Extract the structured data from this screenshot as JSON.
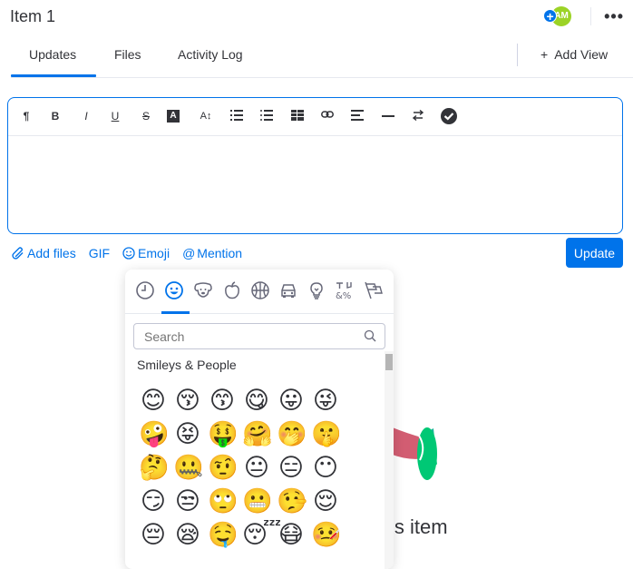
{
  "header": {
    "title": "Item 1",
    "avatar_initials": "AM",
    "add_subscriber_symbol": "+",
    "more_symbol": "•••"
  },
  "tabs": [
    {
      "label": "Updates",
      "active": true
    },
    {
      "label": "Files",
      "active": false
    },
    {
      "label": "Activity Log",
      "active": false
    }
  ],
  "add_view": {
    "icon": "+",
    "label": "Add View"
  },
  "toolbar": {
    "buttons": [
      {
        "name": "paragraph",
        "glyph": "¶"
      },
      {
        "name": "bold",
        "glyph": "B"
      },
      {
        "name": "italic",
        "glyph": "I"
      },
      {
        "name": "underline",
        "glyph": "U"
      },
      {
        "name": "strikethrough",
        "glyph": "S"
      },
      {
        "name": "text-color",
        "glyph": "A"
      },
      {
        "name": "font-size",
        "glyph": "A↕"
      },
      {
        "name": "numbered-list",
        "glyph": "≡"
      },
      {
        "name": "bulleted-list",
        "glyph": "≡"
      },
      {
        "name": "table",
        "glyph": "▦"
      },
      {
        "name": "link",
        "glyph": "∞"
      },
      {
        "name": "align",
        "glyph": "≡"
      },
      {
        "name": "divider",
        "glyph": "—"
      },
      {
        "name": "direction",
        "glyph": "⇆"
      },
      {
        "name": "checklist",
        "glyph": "✔"
      }
    ]
  },
  "actions": {
    "add_files": "Add files",
    "gif": "GIF",
    "emoji": "Emoji",
    "mention": "Mention",
    "update_button": "Update"
  },
  "empty_state": {
    "text_fragment": "is item"
  },
  "emoji_picker": {
    "categories": [
      "recent",
      "smileys",
      "animals",
      "food",
      "activity",
      "travel",
      "objects",
      "symbols",
      "flags"
    ],
    "active_category": "smileys",
    "search_placeholder": "Search",
    "section_label": "Smileys & People",
    "emojis": [
      "😊",
      "😚",
      "😙",
      "😋",
      "😛",
      "😜",
      "🤪",
      "😝",
      "🤑",
      "🤗",
      "🤭",
      "🤫",
      "🤔",
      "🤐",
      "🤨",
      "😐",
      "😑",
      "😶",
      "😏",
      "😒",
      "🙄",
      "😬",
      "🤥",
      "😌",
      "😔",
      "😪",
      "🤤",
      "😴",
      "😷",
      "🤒"
    ]
  },
  "colors": {
    "accent": "#0073ea",
    "avatar": "#9cd326",
    "text": "#323338"
  }
}
